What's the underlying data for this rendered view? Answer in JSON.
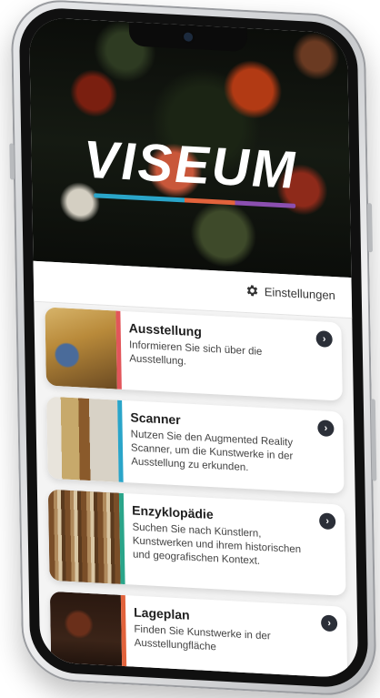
{
  "app": {
    "logo_text": "VISEUM",
    "settings_label": "Einstellungen",
    "settings_icon": "gear-icon"
  },
  "cards": [
    {
      "title": "Ausstellung",
      "description": "Informieren Sie sich über die Ausstellung.",
      "accent": "#e2555a",
      "icon": "chevron-right-icon"
    },
    {
      "title": "Scanner",
      "description": "Nutzen Sie den Augmented Reality Scanner, um die Kunstwerke in der Ausstellung zu erkunden.",
      "accent": "#2aa5c9",
      "icon": "chevron-right-icon"
    },
    {
      "title": "Enzyklopädie",
      "description": "Suchen Sie nach Künstlern, Kunstwerken und ihrem historischen und geografischen Kontext.",
      "accent": "#2aa58a",
      "icon": "chevron-right-icon"
    },
    {
      "title": "Lageplan",
      "description": "Finden Sie Kunstwerke in der Ausstellungfläche",
      "accent": "#e2633c",
      "icon": "chevron-right-icon"
    }
  ],
  "colors": {
    "logo_bar": [
      "#2aa5c9",
      "#e2633c",
      "#8b4fb0"
    ],
    "chevron_bg": "#2b2f38"
  }
}
